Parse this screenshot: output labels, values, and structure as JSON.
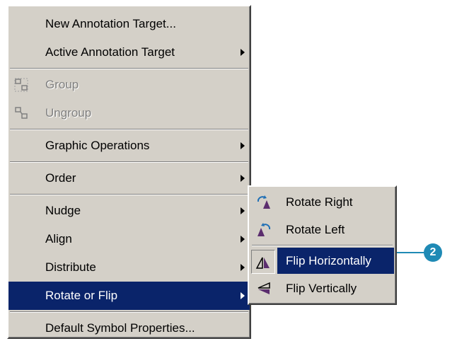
{
  "main_menu": {
    "items": [
      {
        "label": "New Annotation Target..."
      },
      {
        "label": "Active Annotation Target"
      },
      {
        "label": "Group"
      },
      {
        "label": "Ungroup"
      },
      {
        "label": "Graphic Operations"
      },
      {
        "label": "Order"
      },
      {
        "label": "Nudge"
      },
      {
        "label": "Align"
      },
      {
        "label": "Distribute"
      },
      {
        "label": "Rotate or Flip"
      },
      {
        "label": "Default Symbol Properties..."
      }
    ]
  },
  "sub_menu": {
    "items": [
      {
        "label": "Rotate Right",
        "icon": "rotate-right-icon"
      },
      {
        "label": "Rotate Left",
        "icon": "rotate-left-icon"
      },
      {
        "label": "Flip Horizontally",
        "icon": "flip-horizontal-icon"
      },
      {
        "label": "Flip Vertically",
        "icon": "flip-vertical-icon"
      }
    ]
  },
  "callout": {
    "number": "2",
    "color": "#1f8ab5"
  },
  "colors": {
    "menu_bg": "#d4d0c8",
    "highlight": "#0a246a",
    "accent_purple": "#5b2d6e"
  }
}
